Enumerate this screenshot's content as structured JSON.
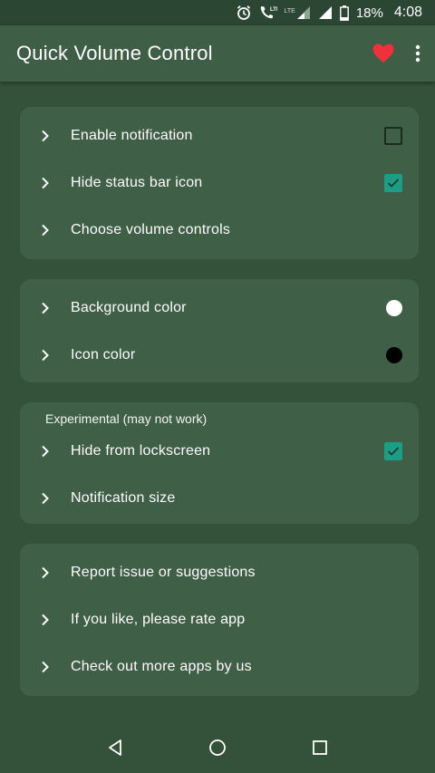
{
  "status_bar": {
    "icons": [
      "alarm-icon",
      "volte-call-icon",
      "lte-signal-icon",
      "signal-icon",
      "battery-icon"
    ],
    "lte_label": "LTE",
    "battery_percent": "18%",
    "time": "4:08"
  },
  "app_bar": {
    "title": "Quick Volume Control",
    "heart_color": "#f0313b"
  },
  "cards": {
    "general": {
      "items": [
        {
          "label": "Enable notification",
          "checkbox": false
        },
        {
          "label": "Hide status bar icon",
          "checkbox": true
        },
        {
          "label": "Choose volume controls"
        }
      ]
    },
    "colors": {
      "items": [
        {
          "label": "Background color",
          "swatch": "#ffffff"
        },
        {
          "label": "Icon color",
          "swatch": "#000000"
        }
      ]
    },
    "experimental": {
      "section_label": "Experimental (may not work)",
      "items": [
        {
          "label": "Hide from lockscreen",
          "checkbox": true
        },
        {
          "label": "Notification size"
        }
      ]
    },
    "about": {
      "items": [
        {
          "label": "Report issue or suggestions"
        },
        {
          "label": "If you like, please rate app"
        },
        {
          "label": "Check out more apps by us"
        }
      ]
    }
  },
  "colors": {
    "background": "#34513a",
    "card": "#3f5f46",
    "accent": "#1c9e86"
  },
  "nav_bar": {
    "buttons": [
      "back-icon",
      "home-icon",
      "recents-icon"
    ]
  }
}
